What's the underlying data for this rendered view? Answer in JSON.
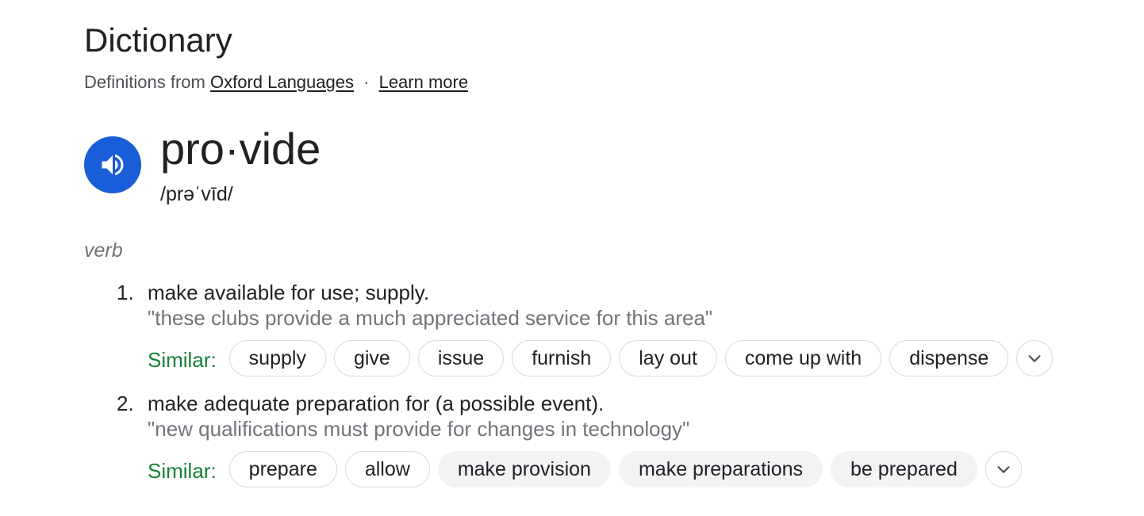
{
  "header": {
    "title": "Dictionary",
    "source_prefix": "Definitions from",
    "source_link": "Oxford Languages",
    "separator": "·",
    "learn_more": "Learn more"
  },
  "entry": {
    "word": "pro·vide",
    "phonetic": "/prəˈvīd/",
    "audio_icon": "speaker-icon",
    "part_of_speech": "verb"
  },
  "senses": [
    {
      "number": "1.",
      "definition": "make available for use; supply.",
      "example": "\"these clubs provide a much appreciated service for this area\"",
      "similar_label": "Similar:",
      "similar": [
        "supply",
        "give",
        "issue",
        "furnish",
        "lay out",
        "come up with",
        "dispense"
      ]
    },
    {
      "number": "2.",
      "definition": "make adequate preparation for (a possible event).",
      "example": "\"new qualifications must provide for changes in technology\"",
      "similar_label": "Similar:",
      "similar": [
        "prepare",
        "allow",
        "make provision",
        "make preparations",
        "be prepared"
      ]
    }
  ],
  "colors": {
    "accent_blue": "#1a5dd8",
    "similar_green": "#188038",
    "muted_text": "#70757a",
    "chip_border": "#dadce0",
    "chip_filled": "#f1f3f4"
  }
}
